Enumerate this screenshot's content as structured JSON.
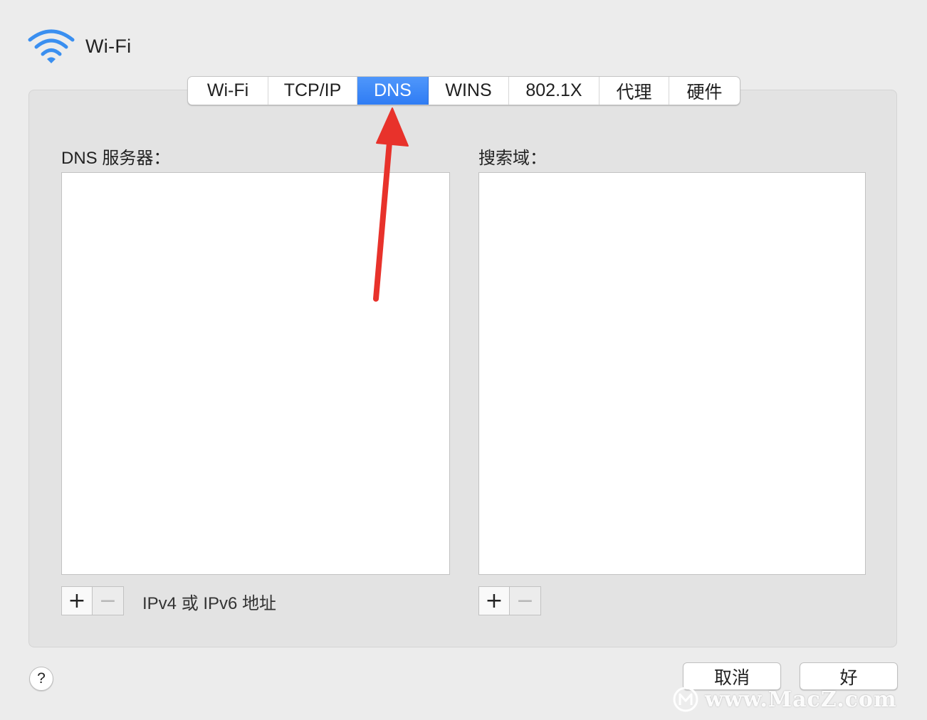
{
  "header": {
    "icon": "wifi-icon",
    "title": "Wi-Fi"
  },
  "tabs": [
    {
      "label": "Wi-Fi",
      "selected": false
    },
    {
      "label": "TCP/IP",
      "selected": false
    },
    {
      "label": "DNS",
      "selected": true
    },
    {
      "label": "WINS",
      "selected": false
    },
    {
      "label": "802.1X",
      "selected": false
    },
    {
      "label": "代理",
      "selected": false
    },
    {
      "label": "硬件",
      "selected": false
    }
  ],
  "dns_servers": {
    "label": "DNS 服务器：",
    "items": [],
    "add_button": "+",
    "remove_button": "−",
    "hint": "IPv4 或 IPv6 地址"
  },
  "search_domains": {
    "label": "搜索域：",
    "items": [],
    "add_button": "+",
    "remove_button": "−"
  },
  "footer": {
    "help_button": "?",
    "cancel_button": "取消",
    "ok_button": "好"
  },
  "annotation": {
    "type": "arrow",
    "color": "#e8322b",
    "points_to": "tab-dns"
  },
  "watermark": {
    "text": "www.MacZ.com"
  },
  "colors": {
    "selected_tab": "#2f7cf4",
    "panel_bg": "#e3e3e3",
    "window_bg": "#ececec"
  }
}
